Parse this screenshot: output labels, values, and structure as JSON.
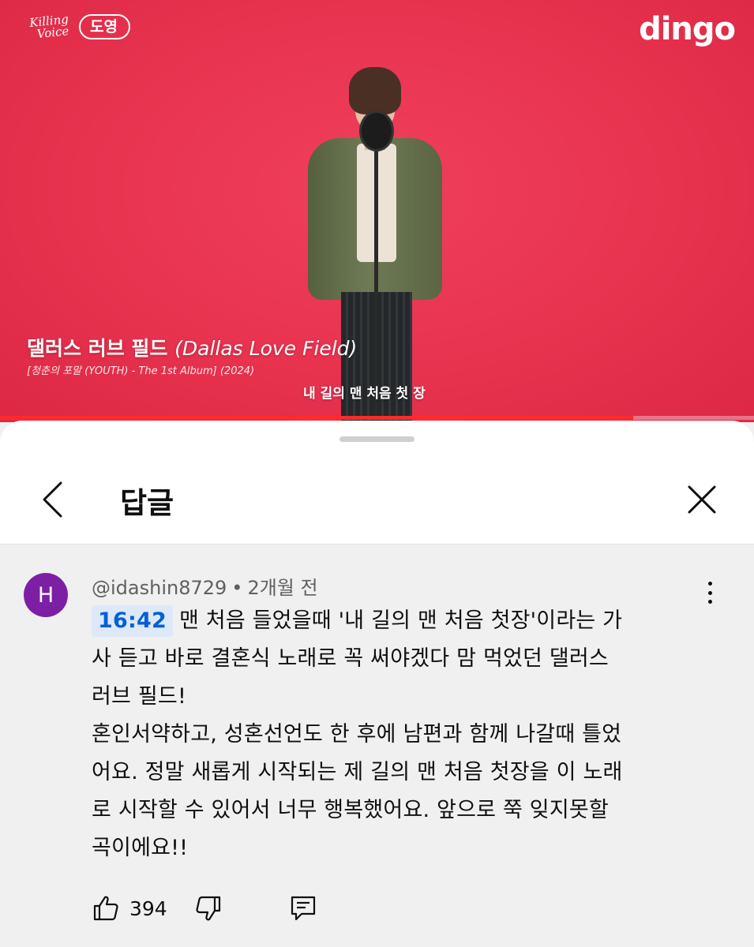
{
  "video": {
    "channel_badge": {
      "line1": "Killing",
      "line2": "Voice",
      "name": "도영"
    },
    "brand": "dingo",
    "song_title": "댈러스 러브 필드",
    "song_title_en": "(Dallas Love Field)",
    "album": "[청춘의 포말 (YOUTH) - The 1st Album] (2024)",
    "lyric": "내 길의 맨 처음 첫 장",
    "progress": 0.84
  },
  "sheet": {
    "title": "답글",
    "back_icon": "chevron-left-icon",
    "close_icon": "close-icon"
  },
  "comment": {
    "avatar_initial": "H",
    "avatar_color": "#7c1fa5",
    "author": "@idashin8729",
    "separator": "•",
    "time_ago": "2개월 전",
    "timestamp": "16:42",
    "lines": [
      "맨 처음 들었을때 '내 길의 맨 처음 첫장'이라는 가",
      "사 듣고 바로 결혼식 노래로 꼭 써야겠다 맘 먹었던 댈러스",
      "러브 필드!",
      "혼인서약하고, 성혼선언도 한 후에 남편과 함께 나갈때 틀었",
      "어요. 정말 새롭게 시작되는 제 길의 맨 처음 첫장을 이 노래",
      "로 시작할 수 있어서 너무 행복했어요. 앞으로 쭉 잊지못할",
      "곡이에요!!"
    ],
    "like_count": "394",
    "icons": [
      "thumbs-up-icon",
      "thumbs-down-icon",
      "reply-icon",
      "more-vert-icon"
    ]
  },
  "colors": {
    "video_bg": "#e8334f",
    "timestamp_text": "#065fd4",
    "timestamp_bg": "#dde8f8",
    "sheet_bg": "#f0f0f0"
  }
}
